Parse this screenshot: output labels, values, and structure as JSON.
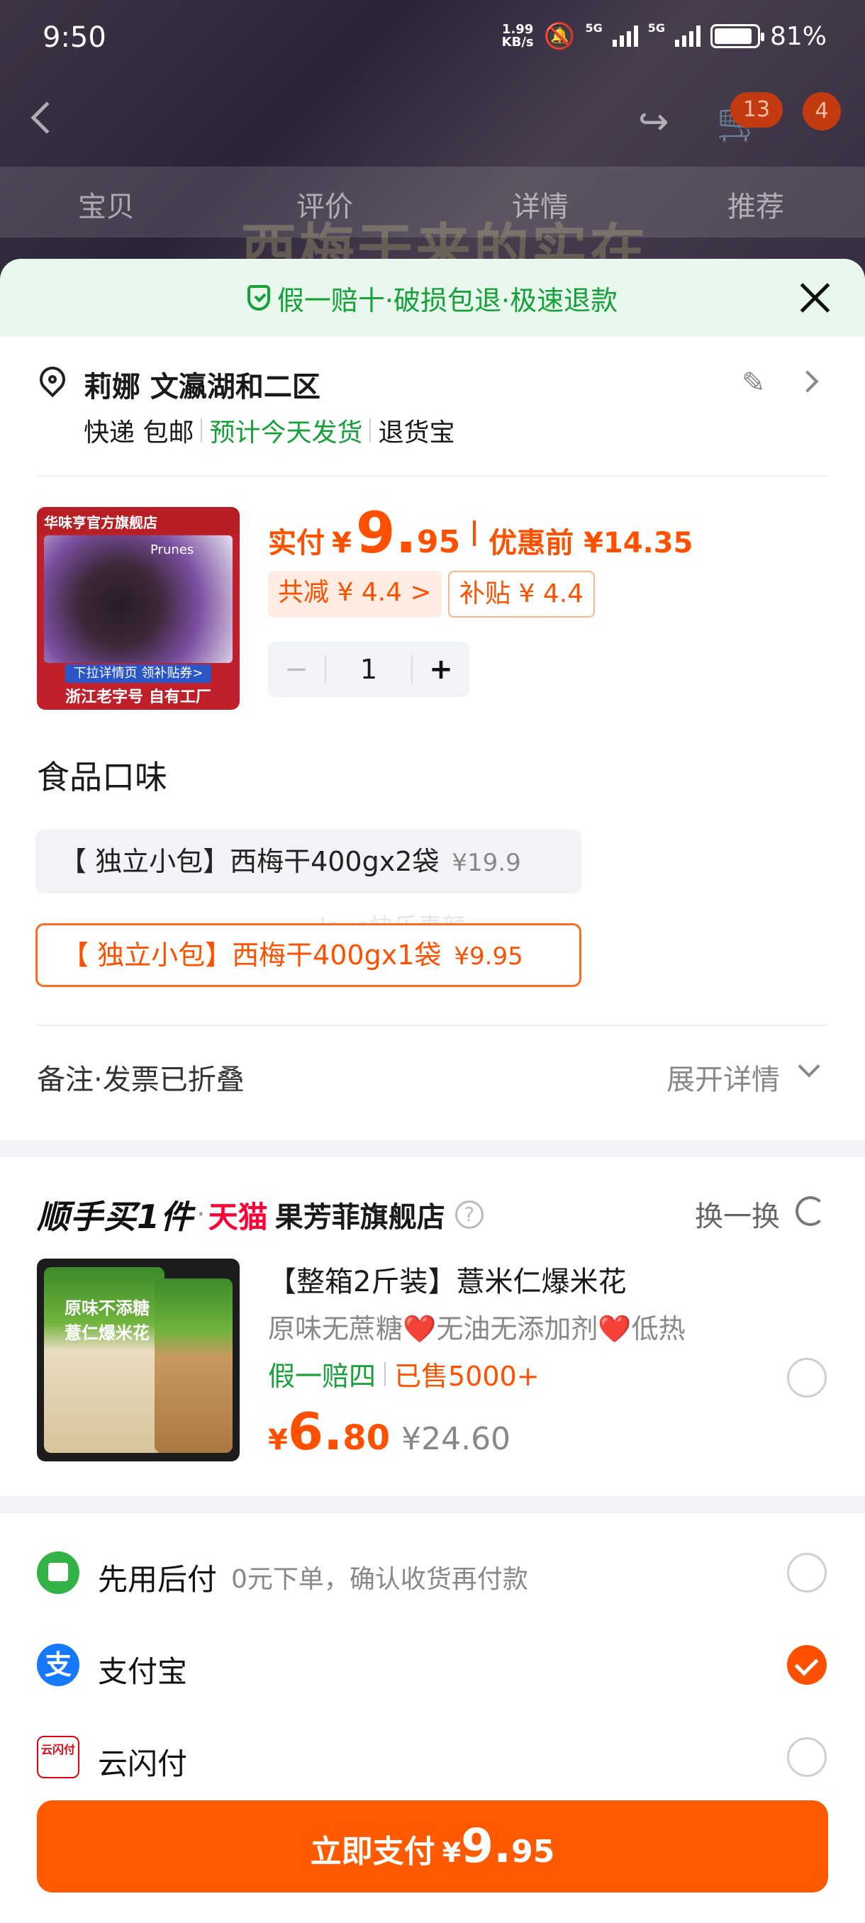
{
  "status_bar": {
    "time": "9:50",
    "net_speed_value": "1.99",
    "net_speed_unit": "KB/s",
    "signal_1": "5G",
    "signal_2": "5G",
    "battery": "81%"
  },
  "background_page": {
    "cart_badge": "13",
    "message_badge": "4",
    "tabs": [
      "宝贝",
      "评价",
      "详情",
      "推荐"
    ],
    "banner_text": "西梅干来的实在"
  },
  "sheet": {
    "guarantee_text": "假一赔十·破损包退·极速退款",
    "address": {
      "name": "莉娜 文瀛湖和二区",
      "shipping_method": "快递 包邮",
      "shipping_eta": "预计今天发货",
      "return_service": "退货宝"
    },
    "product": {
      "image_header": "华味亨官方旗舰店",
      "image_label": "Prunes",
      "image_banner": "下拉详情页 领补贴券>",
      "image_footer": "浙江老字号 自有工厂",
      "price_label": "实付",
      "price_symbol": "¥",
      "price_int": "9.",
      "price_dec": "95",
      "price_before": "优惠前 ¥14.35",
      "reduce_chip": "共减 ¥ 4.4 >",
      "subsidy_chip": "补贴 ¥ 4.4",
      "quantity": "1",
      "minus": "−",
      "plus": "+"
    },
    "flavor": {
      "title": "食品口味",
      "options": [
        {
          "label": "【 独立小包】西梅干400gx2袋",
          "price": "¥19.9",
          "selected": false
        },
        {
          "label": "【 独立小包】西梅干400gx1袋",
          "price": "¥9.95",
          "selected": true
        }
      ],
      "watermark": "love快乐素颜"
    },
    "remark": {
      "label": "备注·发票已折叠",
      "expand": "展开详情"
    },
    "addon": {
      "title": "顺手买1件",
      "dot": "·",
      "platform": "天猫",
      "store": "果芳菲旗舰店",
      "help": "?",
      "swap": "换一换",
      "image_label": "原味不添糖 薏仁爆米花",
      "name": "【整箱2斤装】薏米仁爆米花",
      "desc": "原味无蔗糖❤️无油无添加剂❤️低热",
      "guarantee": "假一赔四",
      "sold": "已售5000+",
      "price_symbol": "¥",
      "price_int": "6.",
      "price_dec": "80",
      "original_price": "¥24.60"
    },
    "payment_methods": [
      {
        "label": "先用后付",
        "sub": "0元下单，确认收货再付款",
        "selected": false,
        "icon": "pay-later-icon"
      },
      {
        "label": "支付宝",
        "sub": "",
        "selected": true,
        "icon": "alipay-icon"
      },
      {
        "label": "云闪付",
        "sub": "",
        "selected": false,
        "icon": "unionpay-icon"
      }
    ],
    "pay_button": {
      "label": "立即支付",
      "symbol": "¥",
      "int": "9.",
      "dec": "95"
    }
  },
  "colors": {
    "accent": "#ff5000",
    "green": "#15a03a",
    "tmall": "#ff0036",
    "alipay": "#1677ff"
  }
}
